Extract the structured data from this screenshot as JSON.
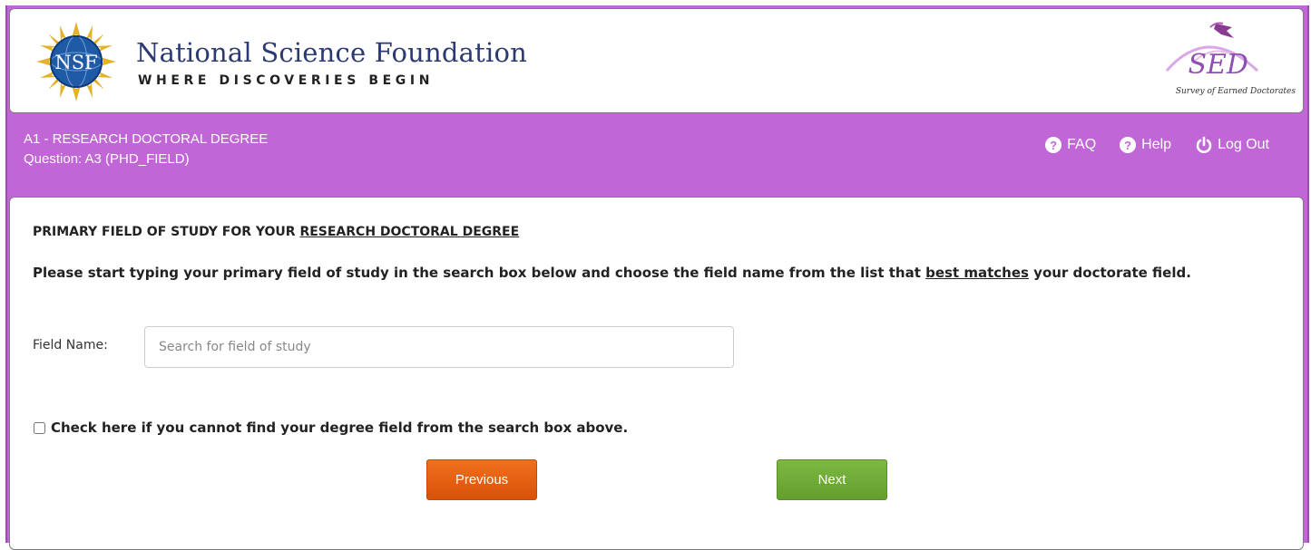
{
  "branding": {
    "org_name": "National Science Foundation",
    "tagline": "WHERE DISCOVERIES BEGIN",
    "nsf_badge": "NSF",
    "sed_letters": "SED",
    "sed_subtitle": "Survey of Earned Doctorates"
  },
  "header": {
    "section": "A1 - RESEARCH DOCTORAL DEGREE",
    "question": "Question: A3 (PHD_FIELD)"
  },
  "nav": {
    "faq_label": "FAQ",
    "help_label": "Help",
    "logout_label": "Log Out"
  },
  "form": {
    "title_prefix": "PRIMARY FIELD OF STUDY FOR YOUR ",
    "title_link": "RESEARCH DOCTORAL DEGREE",
    "instructions_part1": "Please start typing your primary field of study in the search box below and choose the field name from the list that ",
    "instructions_emphasis": "best matches",
    "instructions_part2": " your doctorate field.",
    "field_label": "Field Name:",
    "field_value": "",
    "field_placeholder": "Search for field of study",
    "checkbox_label": "Check here if you cannot find your degree field from the search box above.",
    "checkbox_checked": false,
    "previous_label": "Previous",
    "next_label": "Next"
  },
  "colors": {
    "header_bar": "#c166d6",
    "previous_button": "#e8620f",
    "next_button": "#71ad39"
  }
}
